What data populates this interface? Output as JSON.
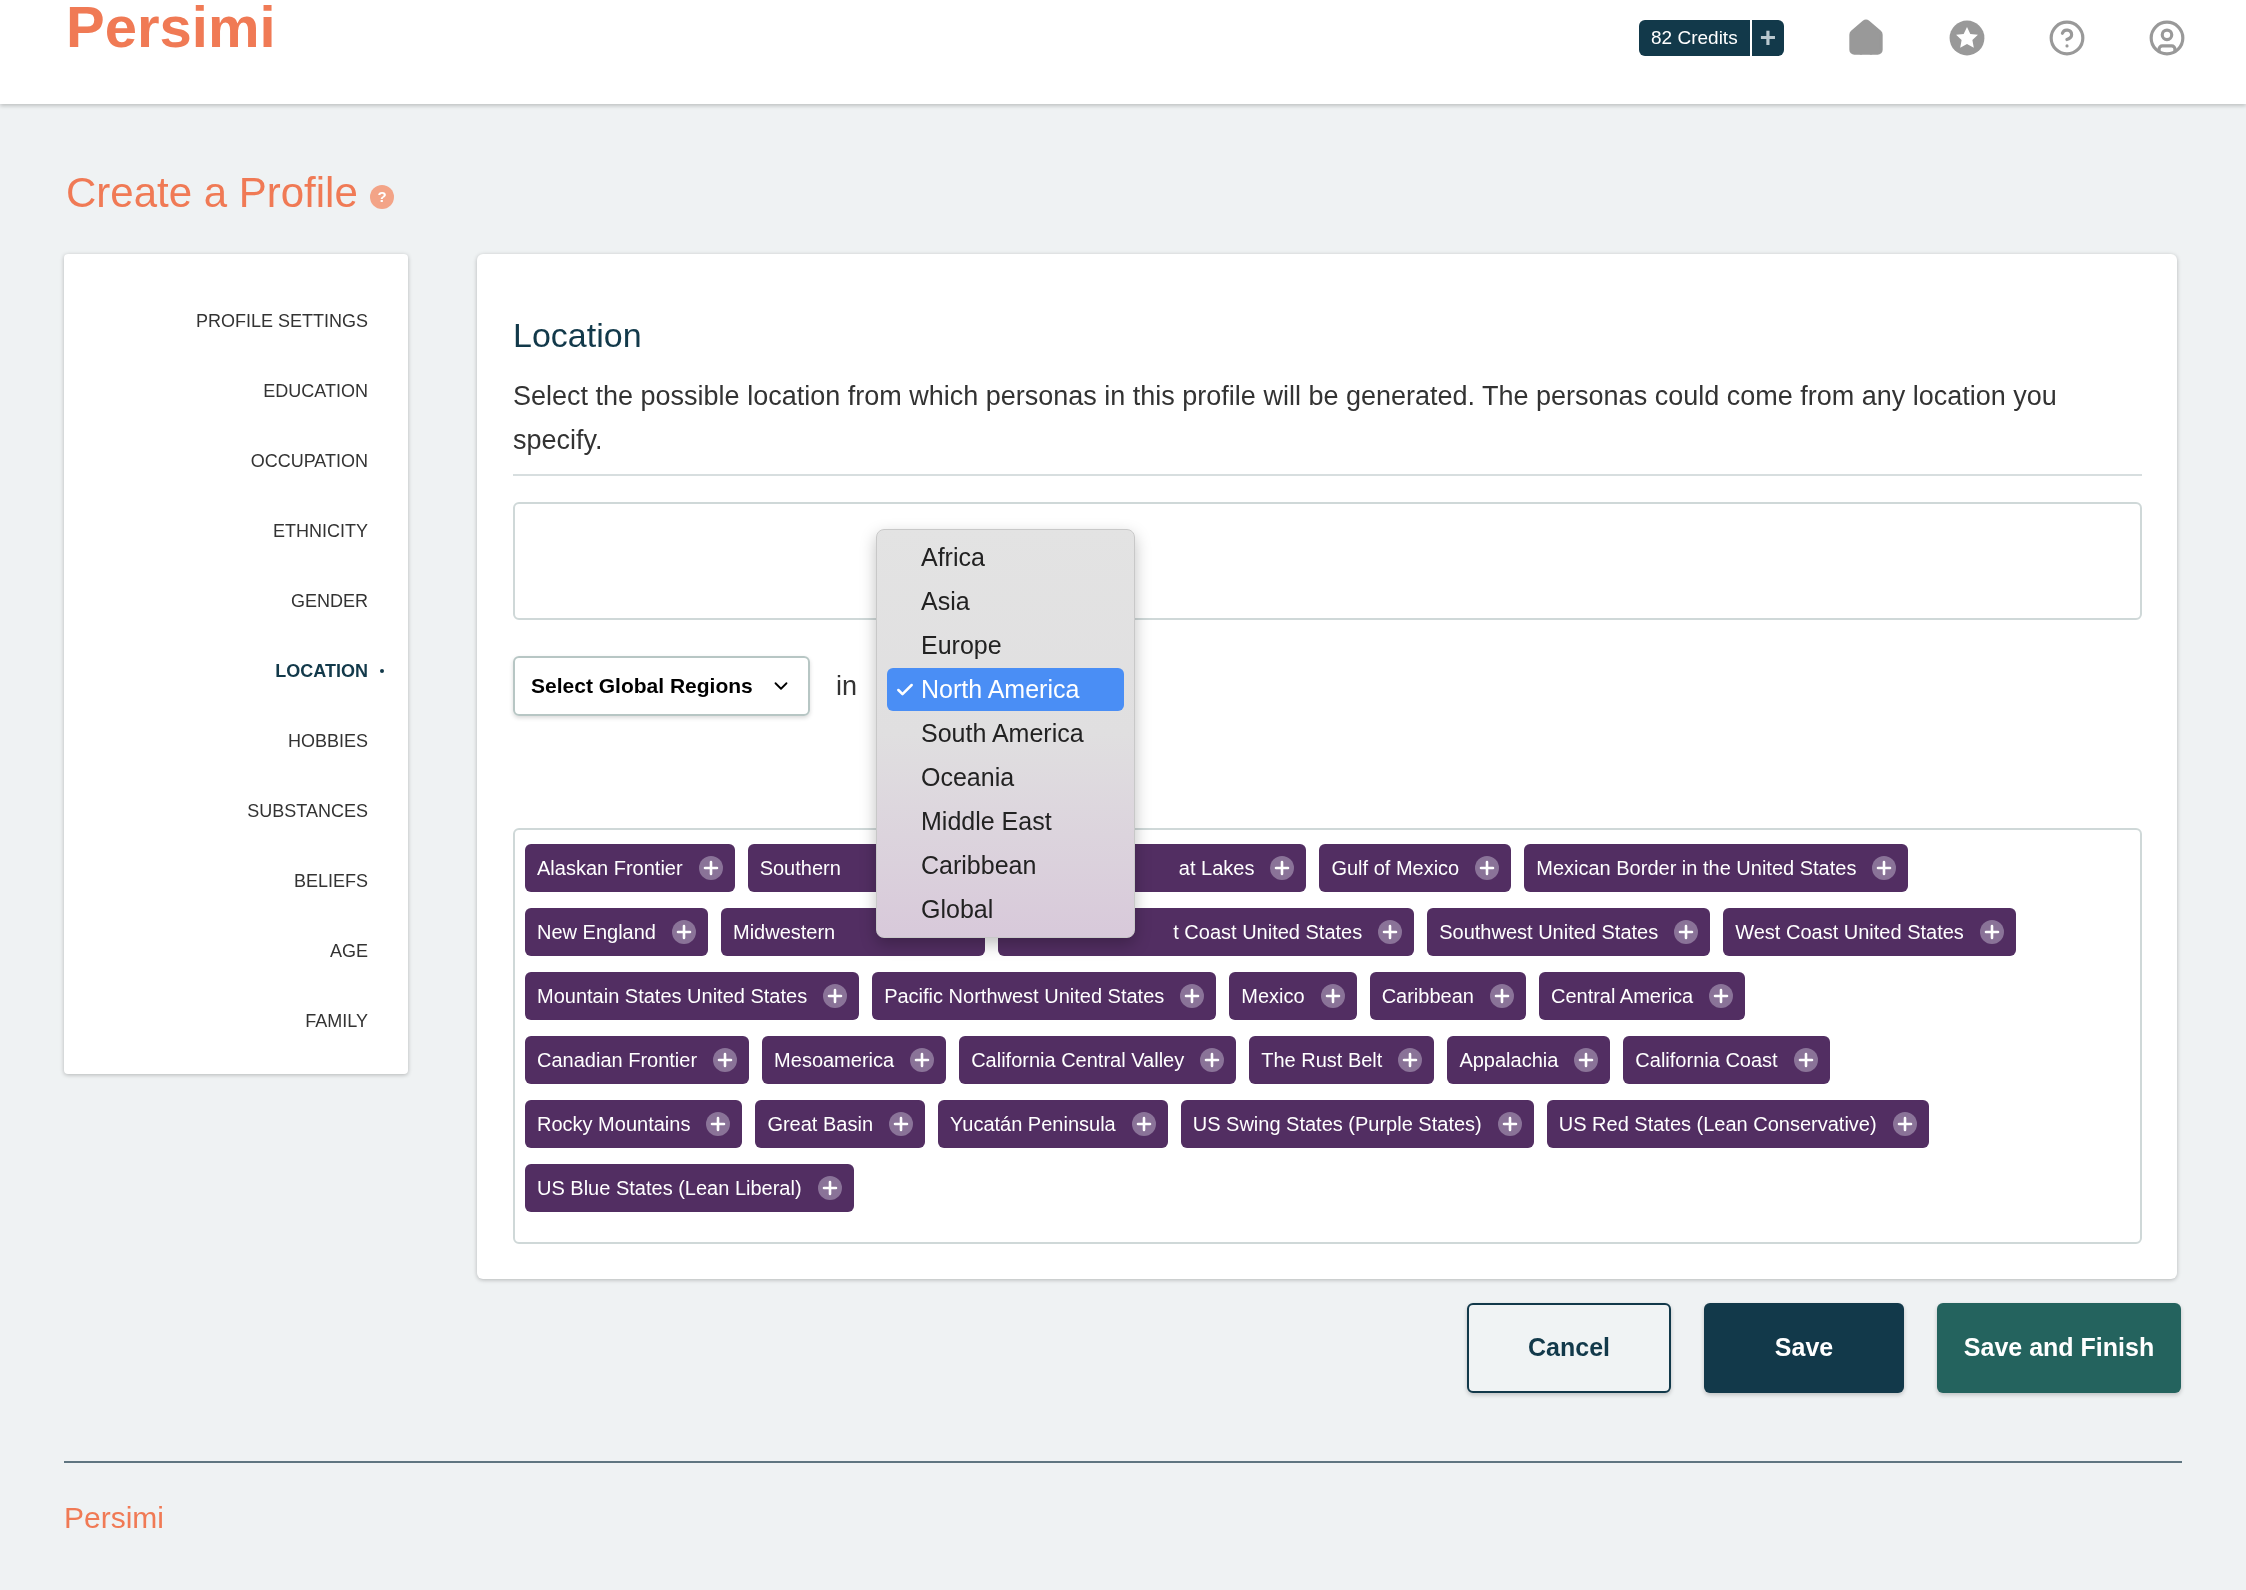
{
  "header": {
    "logo": "Persimi",
    "credits": "82 Credits",
    "credits_add": "+"
  },
  "page_title": "Create a Profile",
  "page_title_help": "?",
  "sidebar": {
    "items": [
      {
        "label": "PROFILE SETTINGS",
        "selected": false
      },
      {
        "label": "EDUCATION",
        "selected": false
      },
      {
        "label": "OCCUPATION",
        "selected": false
      },
      {
        "label": "ETHNICITY",
        "selected": false
      },
      {
        "label": "GENDER",
        "selected": false
      },
      {
        "label": "LOCATION",
        "selected": true
      },
      {
        "label": "HOBBIES",
        "selected": false
      },
      {
        "label": "SUBSTANCES",
        "selected": false
      },
      {
        "label": "BELIEFS",
        "selected": false
      },
      {
        "label": "AGE",
        "selected": false
      },
      {
        "label": "FAMILY",
        "selected": false
      }
    ]
  },
  "section": {
    "title": "Location",
    "description": "Select the possible location from which personas in this profile will be generated. The personas could come from any location you specify.",
    "region_select": {
      "value": "Select Global Regions"
    },
    "connector": "in",
    "dropdown": {
      "options": [
        {
          "label": "Africa",
          "selected": false
        },
        {
          "label": "Asia",
          "selected": false
        },
        {
          "label": "Europe",
          "selected": false
        },
        {
          "label": "North America",
          "selected": true
        },
        {
          "label": "South America",
          "selected": false
        },
        {
          "label": "Oceania",
          "selected": false
        },
        {
          "label": "Middle East",
          "selected": false
        },
        {
          "label": "Caribbean",
          "selected": false
        },
        {
          "label": "Global",
          "selected": false
        }
      ]
    },
    "tag_rows": [
      [
        {
          "label": "Alaskan Frontier",
          "kind": "full"
        },
        {
          "label": "Southern",
          "kind": "cut_right"
        },
        {
          "label": "at Lakes",
          "kind": "cut_left"
        },
        {
          "label": "Gulf of Mexico",
          "kind": "full"
        },
        {
          "label": "Mexican Border in the United States",
          "kind": "full"
        }
      ],
      [
        {
          "label": "New England",
          "kind": "full"
        },
        {
          "label": "Midwestern",
          "kind": "cut_right"
        },
        {
          "label": "t Coast United States",
          "kind": "cut_left"
        },
        {
          "label": "Southwest United States",
          "kind": "full"
        },
        {
          "label": "West Coast United States",
          "kind": "full"
        }
      ],
      [
        {
          "label": "Mountain States United States",
          "kind": "full"
        },
        {
          "label": "Pacific Northwest United States",
          "kind": "full"
        },
        {
          "label": "Mexico",
          "kind": "full"
        },
        {
          "label": "Caribbean",
          "kind": "full"
        },
        {
          "label": "Central America",
          "kind": "full"
        }
      ],
      [
        {
          "label": "Canadian Frontier",
          "kind": "full"
        },
        {
          "label": "Mesoamerica",
          "kind": "full"
        },
        {
          "label": "California Central Valley",
          "kind": "full"
        },
        {
          "label": "The Rust Belt",
          "kind": "full"
        },
        {
          "label": "Appalachia",
          "kind": "full"
        },
        {
          "label": "California Coast",
          "kind": "full"
        }
      ],
      [
        {
          "label": "Rocky Mountains",
          "kind": "full"
        },
        {
          "label": "Great Basin",
          "kind": "full"
        },
        {
          "label": "Yucatán Peninsula",
          "kind": "full"
        },
        {
          "label": "US Swing States (Purple States)",
          "kind": "full"
        },
        {
          "label": "US Red States (Lean Conservative)",
          "kind": "full"
        }
      ],
      [
        {
          "label": "US Blue States (Lean Liberal)",
          "kind": "full"
        }
      ]
    ]
  },
  "buttons": [
    {
      "label": "Cancel",
      "kind": "outline"
    },
    {
      "label": "Save",
      "kind": "primary"
    },
    {
      "label": "Save and Finish",
      "kind": "finish"
    }
  ],
  "footer": {
    "logo": "Persimi"
  }
}
